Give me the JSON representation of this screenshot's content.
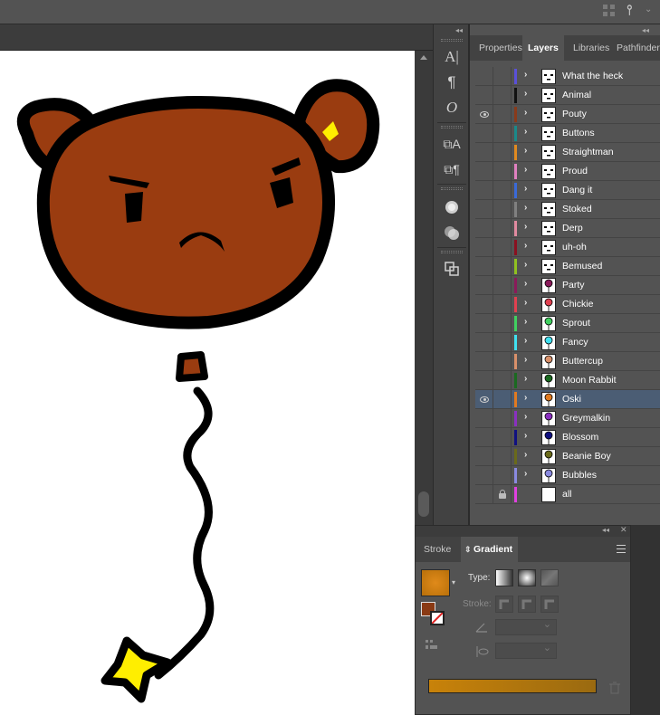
{
  "layers_panel": {
    "tabs": [
      {
        "label": "Properties",
        "active": false
      },
      {
        "label": "Layers",
        "active": true
      },
      {
        "label": "Libraries",
        "active": false
      },
      {
        "label": "Pathfinder",
        "active": false
      }
    ],
    "layers": [
      {
        "name": "What the heck",
        "color": "#5a50d8",
        "visible": false,
        "locked": false,
        "selected": false,
        "icon": "face-icon"
      },
      {
        "name": "Animal",
        "color": "#111111",
        "visible": false,
        "locked": false,
        "selected": false,
        "icon": "face-icon"
      },
      {
        "name": "Pouty",
        "color": "#8a3a1a",
        "visible": true,
        "locked": false,
        "selected": false,
        "icon": "face-icon"
      },
      {
        "name": "Buttons",
        "color": "#1a8a8a",
        "visible": false,
        "locked": false,
        "selected": false,
        "icon": "face-icon"
      },
      {
        "name": "Straightman",
        "color": "#e08a20",
        "visible": false,
        "locked": false,
        "selected": false,
        "icon": "face-icon"
      },
      {
        "name": "Proud",
        "color": "#e080c0",
        "visible": false,
        "locked": false,
        "selected": false,
        "icon": "face-icon"
      },
      {
        "name": "Dang it",
        "color": "#3a6ad8",
        "visible": false,
        "locked": false,
        "selected": false,
        "icon": "face-icon"
      },
      {
        "name": "Stoked",
        "color": "#808080",
        "visible": false,
        "locked": false,
        "selected": false,
        "icon": "face-icon"
      },
      {
        "name": "Derp",
        "color": "#e08aa0",
        "visible": false,
        "locked": false,
        "selected": false,
        "icon": "face-icon"
      },
      {
        "name": "uh-oh",
        "color": "#8a1020",
        "visible": false,
        "locked": false,
        "selected": false,
        "icon": "face-icon"
      },
      {
        "name": "Bemused",
        "color": "#90c020",
        "visible": false,
        "locked": false,
        "selected": false,
        "icon": "face-icon"
      },
      {
        "name": "Party",
        "color": "#8a1a5a",
        "visible": false,
        "locked": false,
        "selected": false,
        "icon": "balloon-icon"
      },
      {
        "name": "Chickie",
        "color": "#e04050",
        "visible": false,
        "locked": false,
        "selected": false,
        "icon": "balloon-icon"
      },
      {
        "name": "Sprout",
        "color": "#40d060",
        "visible": false,
        "locked": false,
        "selected": false,
        "icon": "balloon-icon"
      },
      {
        "name": "Fancy",
        "color": "#40e0f0",
        "visible": false,
        "locked": false,
        "selected": false,
        "icon": "balloon-icon"
      },
      {
        "name": "Buttercup",
        "color": "#d8906a",
        "visible": false,
        "locked": false,
        "selected": false,
        "icon": "balloon-icon"
      },
      {
        "name": "Moon Rabbit",
        "color": "#1a6a20",
        "visible": false,
        "locked": false,
        "selected": false,
        "icon": "balloon-icon"
      },
      {
        "name": "Oski",
        "color": "#e07a20",
        "visible": true,
        "locked": false,
        "selected": true,
        "icon": "balloon-icon"
      },
      {
        "name": "Greymalkin",
        "color": "#8a30c0",
        "visible": false,
        "locked": false,
        "selected": false,
        "icon": "balloon-icon"
      },
      {
        "name": "Blossom",
        "color": "#101080",
        "visible": false,
        "locked": false,
        "selected": false,
        "icon": "balloon-icon"
      },
      {
        "name": "Beanie Boy",
        "color": "#6a6a1a",
        "visible": false,
        "locked": false,
        "selected": false,
        "icon": "balloon-icon"
      },
      {
        "name": "Bubbles",
        "color": "#8a8ae0",
        "visible": false,
        "locked": false,
        "selected": false,
        "icon": "balloon-icon"
      },
      {
        "name": "all",
        "color": "#e040e0",
        "visible": false,
        "locked": true,
        "selected": false,
        "icon": "blank"
      }
    ]
  },
  "gradient_panel": {
    "tabs": [
      {
        "label": "Stroke",
        "active": false
      },
      {
        "label": "Gradient",
        "active": true
      }
    ],
    "type_label": "Type:",
    "stroke_label": "Stroke:",
    "gradient_start": "#c8820a",
    "gradient_end": "#9a6a10",
    "fill_color": "#8a3a14"
  },
  "tools": [
    "character-icon",
    "paragraph-icon",
    "opentype-icon",
    "character-styles-icon",
    "paragraph-styles-icon",
    "appearance-icon",
    "transparency-icon",
    "align-icon"
  ],
  "canvas": {
    "bear_color": "#9a3c10",
    "ear_inner_color": "#ffee00",
    "star_color": "#ffee00"
  }
}
